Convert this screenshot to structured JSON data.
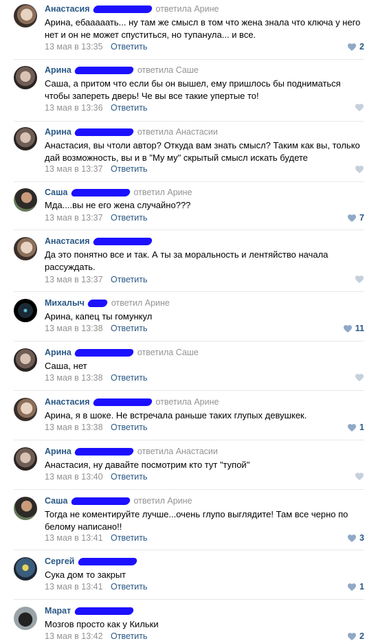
{
  "reply_label": "Ответить",
  "comments": [
    {
      "author": "Анастасия",
      "reply_to": "ответила Арине",
      "text": "Арина, ебааааать...  ну там же смысл в том что жена знала что ключа у него нет и он не может спуститься, но тупанула... и все.",
      "date": "13 мая в 13:35",
      "likes": "2"
    },
    {
      "author": "Арина",
      "reply_to": "ответила Саше",
      "text": "Саша, а притом что если бы он вышел, ему пришлось бы подниматься чтобы запереть дверь! Че вы все такие упертые то!",
      "date": "13 мая в 13:36",
      "likes": ""
    },
    {
      "author": "Арина",
      "reply_to": "ответила Анастасии",
      "text": "Анастасия, вы чтоли автор? Откуда вам знать смысл? Таким как вы, только дай возможность, вы и в \"Му му\" скрытый смысл искать будете",
      "date": "13 мая в 13:37",
      "likes": ""
    },
    {
      "author": "Саша",
      "reply_to": "ответил Арине",
      "text": "Мда....вы не его жена случайно???",
      "date": "13 мая в 13:37",
      "likes": "7"
    },
    {
      "author": "Анастасия",
      "reply_to": "",
      "text": "Да это понятно все и так. А ты за моральность и лентяйство начала рассуждать.",
      "date": "13 мая в 13:37",
      "likes": ""
    },
    {
      "author": "Михалыч",
      "reply_to": "ответил Арине",
      "text": "Арина, капец ты гомункул",
      "date": "13 мая в 13:38",
      "likes": "11"
    },
    {
      "author": "Арина",
      "reply_to": "ответила Саше",
      "text": "Саша, нет",
      "date": "13 мая в 13:38",
      "likes": ""
    },
    {
      "author": "Анастасия",
      "reply_to": "ответила Арине",
      "text": "Арина, я в шоке. Не встречала раньше таких глупых девушкек.",
      "date": "13 мая в 13:38",
      "likes": "1"
    },
    {
      "author": "Арина",
      "reply_to": "ответила Анастасии",
      "text": "Анастасия, ну давайте посмотрим кто тут \"тупой\"",
      "date": "13 мая в 13:40",
      "likes": ""
    },
    {
      "author": "Саша",
      "reply_to": "ответил Арине",
      "text": "Тогда не коментируйте лучше...очень глупо выглядите! Там все черно по белому написано!!",
      "date": "13 мая в 13:41",
      "likes": "3"
    },
    {
      "author": "Сергей",
      "reply_to": "",
      "text": "Сука дом то закрыт",
      "date": "13 мая в 13:41",
      "likes": "1"
    },
    {
      "author": "Марат",
      "reply_to": "",
      "text": "Мозгов просто как у Кильки",
      "date": "13 мая в 13:42",
      "likes": "2"
    }
  ]
}
